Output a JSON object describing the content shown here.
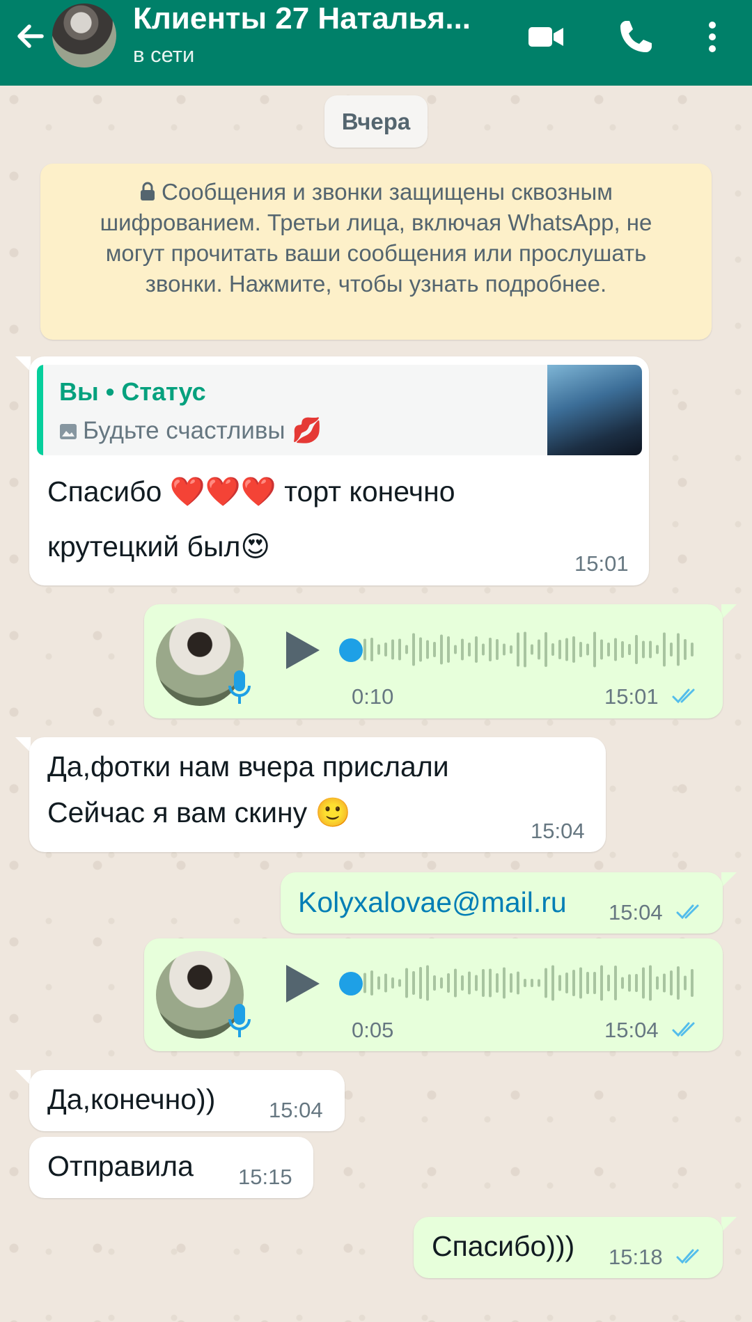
{
  "header": {
    "title": "Клиенты 27 Наталья...",
    "status": "в сети"
  },
  "date_chip": "Вчера",
  "encryption_notice": "Сообщения и звонки защищены сквозным шифрованием. Третьи лица, включая WhatsApp, не могут прочитать ваши сообщения или прослушать звонки. Нажмите, чтобы узнать подробнее.",
  "messages": [
    {
      "direction": "in",
      "quote_author": "Вы • Статус",
      "quote_text": "Будьте счастливы 💋",
      "text_line1": "Спасибо ❤️❤️❤️ торт конечно",
      "text_line2": "крутецкий был😍",
      "time": "15:01"
    },
    {
      "direction": "out",
      "type": "voice",
      "duration": "0:10",
      "time": "15:01",
      "status": "read"
    },
    {
      "direction": "in",
      "text_line1": "Да,фотки нам вчера прислали",
      "text_line2": "Сейчас я вам скину 🙂",
      "time": "15:04"
    },
    {
      "direction": "out",
      "text": "Kolyxalovae@mail.ru",
      "time": "15:04",
      "status": "read"
    },
    {
      "direction": "out",
      "type": "voice",
      "duration": "0:05",
      "time": "15:04",
      "status": "read"
    },
    {
      "direction": "in",
      "text": "Да,конечно))",
      "time": "15:04"
    },
    {
      "direction": "in",
      "text": "Отправила",
      "time": "15:15"
    },
    {
      "direction": "out",
      "text": "Спасибо)))",
      "time": "15:18",
      "status": "read"
    }
  ],
  "colors": {
    "header": "#008069",
    "outgoing_bubble": "#e7ffdb",
    "incoming_bubble": "#ffffff",
    "read_ticks": "#53bdeb",
    "quote_accent": "#06cf9c"
  }
}
